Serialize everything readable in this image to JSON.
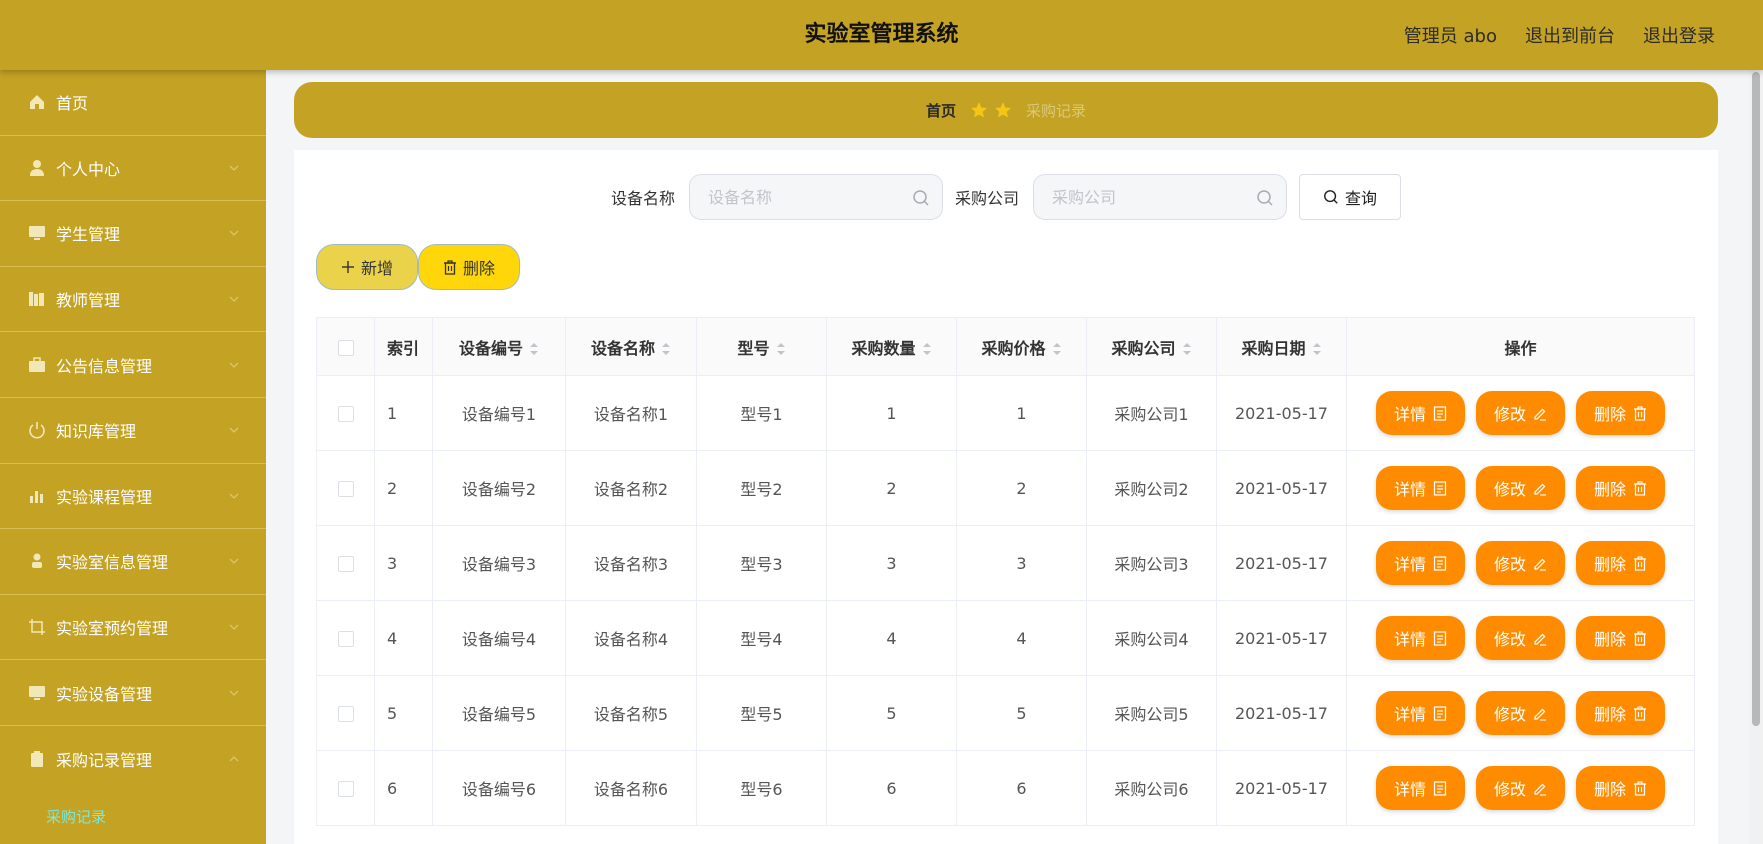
{
  "header": {
    "title": "实验室管理系统",
    "user_label": "管理员 abo",
    "front_link": "退出到前台",
    "logout_link": "退出登录"
  },
  "sidebar": {
    "items": [
      {
        "label": "首页",
        "icon": "home-icon"
      },
      {
        "label": "个人中心",
        "icon": "user-icon"
      },
      {
        "label": "学生管理",
        "icon": "monitor-icon"
      },
      {
        "label": "教师管理",
        "icon": "books-icon"
      },
      {
        "label": "公告信息管理",
        "icon": "briefcase-icon"
      },
      {
        "label": "知识库管理",
        "icon": "power-icon"
      },
      {
        "label": "实验课程管理",
        "icon": "bar-chart-icon"
      },
      {
        "label": "实验室信息管理",
        "icon": "person-icon"
      },
      {
        "label": "实验室预约管理",
        "icon": "crop-icon"
      },
      {
        "label": "实验设备管理",
        "icon": "monitor-icon"
      },
      {
        "label": "采购记录管理",
        "icon": "clipboard-icon"
      }
    ],
    "subitem": "采购记录"
  },
  "breadcrumb": {
    "home": "首页",
    "current": "采购记录"
  },
  "search": {
    "name_label": "设备名称",
    "name_placeholder": "设备名称",
    "company_label": "采购公司",
    "company_placeholder": "采购公司",
    "query_label": "查询"
  },
  "actions": {
    "add_label": "新增",
    "delete_label": "删除"
  },
  "table": {
    "columns": [
      "索引",
      "设备编号",
      "设备名称",
      "型号",
      "采购数量",
      "采购价格",
      "采购公司",
      "采购日期",
      "操作"
    ],
    "rows": [
      {
        "index": "1",
        "code": "设备编号1",
        "name": "设备名称1",
        "model": "型号1",
        "qty": "1",
        "price": "1",
        "company": "采购公司1",
        "date": "2021-05-17"
      },
      {
        "index": "2",
        "code": "设备编号2",
        "name": "设备名称2",
        "model": "型号2",
        "qty": "2",
        "price": "2",
        "company": "采购公司2",
        "date": "2021-05-17"
      },
      {
        "index": "3",
        "code": "设备编号3",
        "name": "设备名称3",
        "model": "型号3",
        "qty": "3",
        "price": "3",
        "company": "采购公司3",
        "date": "2021-05-17"
      },
      {
        "index": "4",
        "code": "设备编号4",
        "name": "设备名称4",
        "model": "型号4",
        "qty": "4",
        "price": "4",
        "company": "采购公司4",
        "date": "2021-05-17"
      },
      {
        "index": "5",
        "code": "设备编号5",
        "name": "设备名称5",
        "model": "型号5",
        "qty": "5",
        "price": "5",
        "company": "采购公司5",
        "date": "2021-05-17"
      },
      {
        "index": "6",
        "code": "设备编号6",
        "name": "设备名称6",
        "model": "型号6",
        "qty": "6",
        "price": "6",
        "company": "采购公司6",
        "date": "2021-05-17"
      }
    ],
    "op_detail": "详情",
    "op_edit": "修改",
    "op_delete": "删除"
  },
  "colors": {
    "theme": "#c4a224",
    "action_orange": "#ff8c00",
    "submenu_active": "#7fe8d6"
  }
}
